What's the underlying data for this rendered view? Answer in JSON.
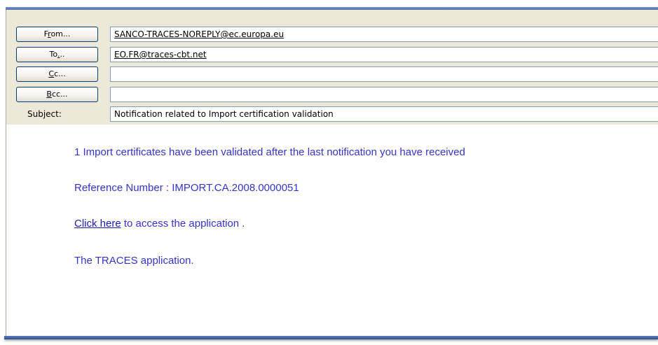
{
  "header": {
    "from": {
      "label_before": "F",
      "label_accel": "r",
      "label_after": "om...",
      "value": "SANCO-TRACES-NOREPLY@ec.europa.eu"
    },
    "to": {
      "label_before": "To",
      "label_accel": ".",
      "label_after": "..",
      "value": "EO.FR@traces-cbt.net"
    },
    "cc": {
      "label_before": "",
      "label_accel": "C",
      "label_after": "c...",
      "value": ""
    },
    "bcc": {
      "label_before": "",
      "label_accel": "B",
      "label_after": "cc...",
      "value": ""
    },
    "subject": {
      "label": "Subject:",
      "value": "Notification related to Import certification validation"
    }
  },
  "message": {
    "line1": "1 Import certificates have been validated after the last notification you have received",
    "line2": "Reference Number : IMPORT.CA.2008.0000051",
    "link_text": "Click here",
    "line3_rest": " to access the application .",
    "line4": "The TRACES application."
  },
  "colors": {
    "window_bg": "#ece9d8",
    "button_border": "#003c74",
    "field_border": "#7f9db9",
    "message_text": "#3333cc",
    "link": "#1a1ab8"
  }
}
